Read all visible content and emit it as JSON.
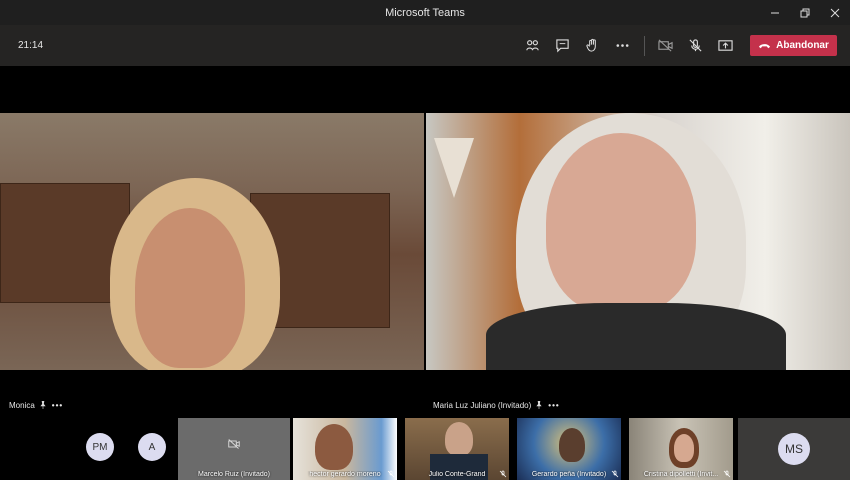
{
  "window": {
    "title": "Microsoft Teams"
  },
  "toolbar": {
    "clock": "21:14",
    "leave_label": "Abandonar"
  },
  "stage": {
    "left_name": "Monica",
    "right_name": "Maria Luz Juliano (Invitado)",
    "more": "•••"
  },
  "strip": {
    "avatars": [
      "PM",
      "A"
    ],
    "thumbnails": [
      "Marcelo Ruiz (Invitado)",
      "hector gerardo moreno",
      "Julio Conte-Grand",
      "Gerardo peña (Invitado)",
      "Cristina dipolletti (Invit..."
    ],
    "overflow_avatar": "MS"
  },
  "colors": {
    "leave": "#c4314b",
    "toolbar": "#252423",
    "titlebar": "#1f1f1f"
  }
}
